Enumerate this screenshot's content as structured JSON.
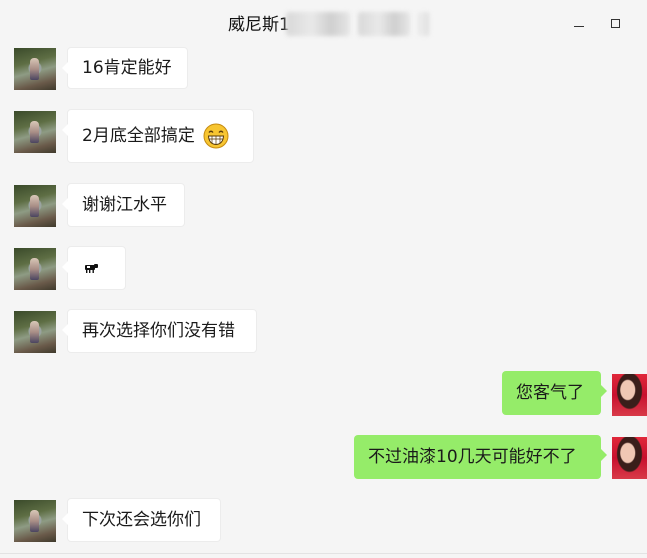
{
  "window": {
    "title_visible": "威尼斯1",
    "minimize_icon": "minimize-icon",
    "maximize_icon": "maximize-icon"
  },
  "messages": [
    {
      "side": "left",
      "text": "16肯定能好"
    },
    {
      "side": "left",
      "text": "2月底全部搞定",
      "emoji": "grinning-face-icon"
    },
    {
      "side": "left",
      "text": "谢谢江水平"
    },
    {
      "side": "left",
      "text": "",
      "emoji": "cow-icon"
    },
    {
      "side": "left",
      "text": "再次选择你们没有错"
    },
    {
      "side": "right",
      "text": "您客气了"
    },
    {
      "side": "right",
      "text": "不过油漆10几天可能好不了"
    },
    {
      "side": "left",
      "text": "下次还会选你们"
    }
  ],
  "colors": {
    "background": "#f5f5f5",
    "received_bubble": "#ffffff",
    "sent_bubble": "#95ec69"
  }
}
